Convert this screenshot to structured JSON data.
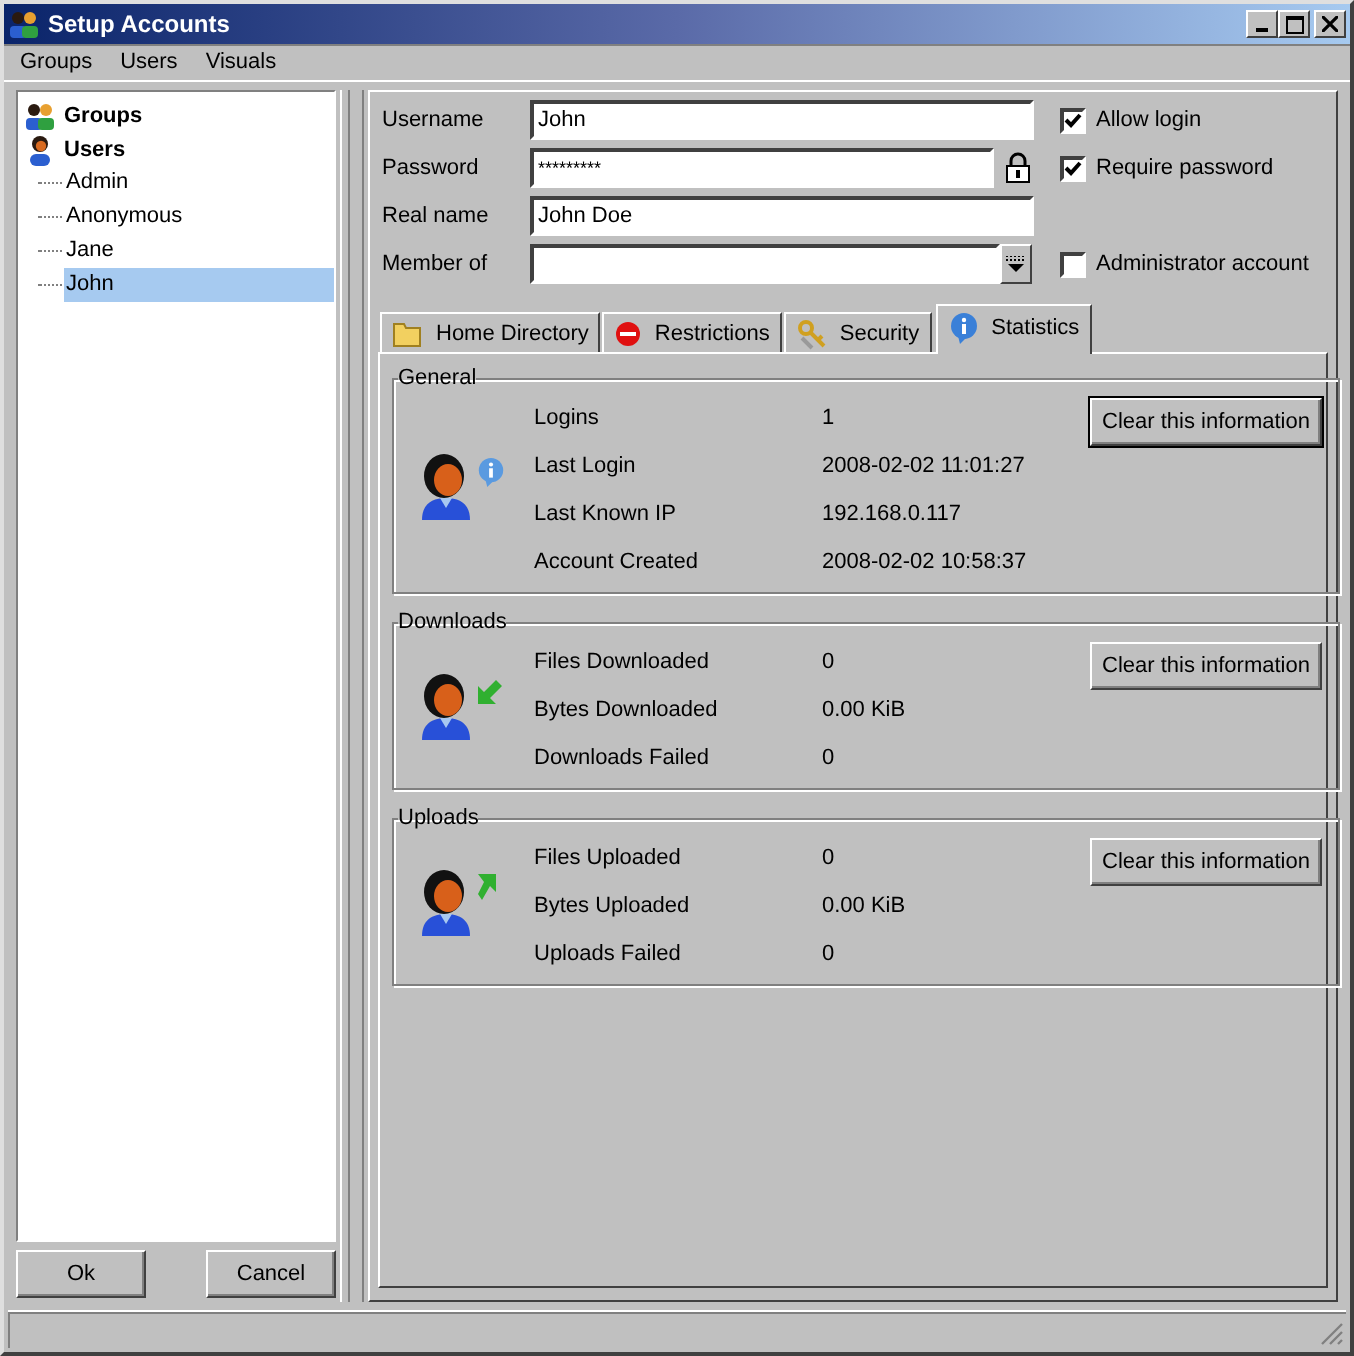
{
  "window": {
    "title": "Setup Accounts"
  },
  "menu": [
    "Groups",
    "Users",
    "Visuals"
  ],
  "tree": [
    {
      "label": "Groups",
      "kind": "group"
    },
    {
      "label": "Users",
      "kind": "user",
      "children": [
        {
          "label": "Admin",
          "selected": false
        },
        {
          "label": "Anonymous",
          "selected": false
        },
        {
          "label": "Jane",
          "selected": false
        },
        {
          "label": "John",
          "selected": true
        }
      ]
    }
  ],
  "buttons": [
    "Ok",
    "Cancel"
  ],
  "fields": [
    {
      "label": "Username",
      "kind": "text",
      "value": "John",
      "option": {
        "label": "Allow login",
        "checked": true
      }
    },
    {
      "label": "Password",
      "kind": "password",
      "value": "*********",
      "option": {
        "label": "Require password",
        "checked": true
      }
    },
    {
      "label": "Real name",
      "kind": "text",
      "value": "John Doe"
    },
    {
      "label": "Member of",
      "kind": "combo",
      "option": {
        "label": "Administrator account",
        "checked": false
      }
    }
  ],
  "tabs": [
    {
      "label": "Home Directory",
      "kind": "folder",
      "selected": false
    },
    {
      "label": "Restrictions",
      "kind": "stop",
      "selected": false
    },
    {
      "label": "Security",
      "kind": "keys",
      "selected": false
    },
    {
      "label": "Statistics",
      "kind": "info",
      "selected": true
    }
  ],
  "sections": [
    {
      "title": "General",
      "kind": "info",
      "button": "Clear this information",
      "rows": [
        {
          "label": "Logins",
          "value": "1"
        },
        {
          "label": "Last Login",
          "value": "2008-02-02 11:01:27"
        },
        {
          "label": "Last Known IP",
          "value": "192.168.0.117"
        },
        {
          "label": "Account Created",
          "value": "2008-02-02 10:58:37"
        }
      ]
    },
    {
      "title": "Downloads",
      "kind": "download",
      "button": "Clear this information",
      "rows": [
        {
          "label": "Files Downloaded",
          "value": "0"
        },
        {
          "label": "Bytes Downloaded",
          "value": "0.00 KiB"
        },
        {
          "label": "Downloads Failed",
          "value": "0"
        }
      ]
    },
    {
      "title": "Uploads",
      "kind": "upload",
      "button": "Clear this information",
      "rows": [
        {
          "label": "Files Uploaded",
          "value": "0"
        },
        {
          "label": "Bytes Uploaded",
          "value": "0.00 KiB"
        },
        {
          "label": "Uploads Failed",
          "value": "0"
        }
      ]
    }
  ]
}
